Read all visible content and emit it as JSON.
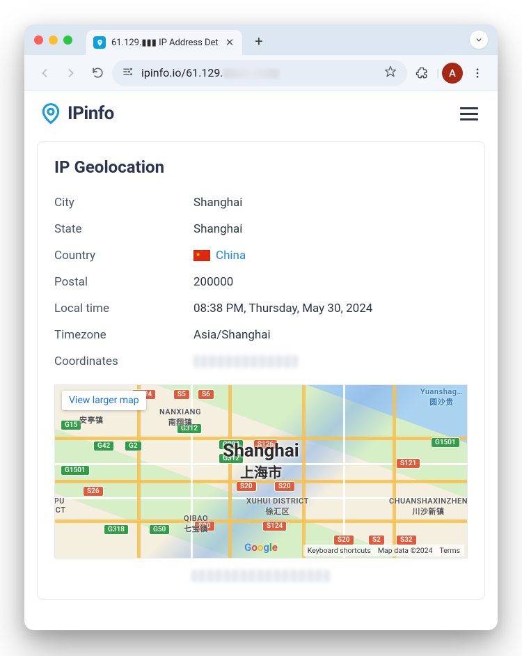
{
  "browser": {
    "tab_title": "61.129.▮▮▮ IP Address Det",
    "url_prefix": "ipinfo.io/61.129.",
    "avatar_letter": "A"
  },
  "site": {
    "logo_text": "IPinfo"
  },
  "card": {
    "title": "IP Geolocation",
    "rows": {
      "city": {
        "label": "City",
        "value": "Shanghai"
      },
      "state": {
        "label": "State",
        "value": "Shanghai"
      },
      "country": {
        "label": "Country",
        "value": "China"
      },
      "postal": {
        "label": "Postal",
        "value": "200000"
      },
      "localtime": {
        "label": "Local time",
        "value": "08:38 PM, Thursday, May 30, 2024"
      },
      "timezone": {
        "label": "Timezone",
        "value": "Asia/Shanghai"
      },
      "coordinates": {
        "label": "Coordinates"
      }
    }
  },
  "map": {
    "view_larger": "View larger map",
    "city_en": "Shanghai",
    "city_zh": "上海市",
    "districts": {
      "xuhui": "XUHUI DISTRICT\n徐汇区",
      "qibao": "QIBAO\n七宝镇",
      "chuansha": "CHUANSHAXINZHEN\n川沙新镇",
      "pu": "PU\nICT",
      "yuanshang": "Yuanshag…\n圆沙贵",
      "anting": "安亭镇",
      "nanxiang": "NANXIANG\n南翔镇"
    },
    "badges": [
      "S20",
      "S20",
      "S20",
      "S20",
      "S5",
      "S6",
      "S26",
      "S32",
      "S224",
      "S2",
      "G15",
      "G2",
      "G42",
      "G50",
      "G1501",
      "G1501",
      "G204",
      "G312",
      "G312",
      "G318",
      "S124",
      "S126",
      "S121"
    ],
    "attr": {
      "shortcuts": "Keyboard shortcuts",
      "data": "Map data ©2024",
      "terms": "Terms"
    }
  }
}
